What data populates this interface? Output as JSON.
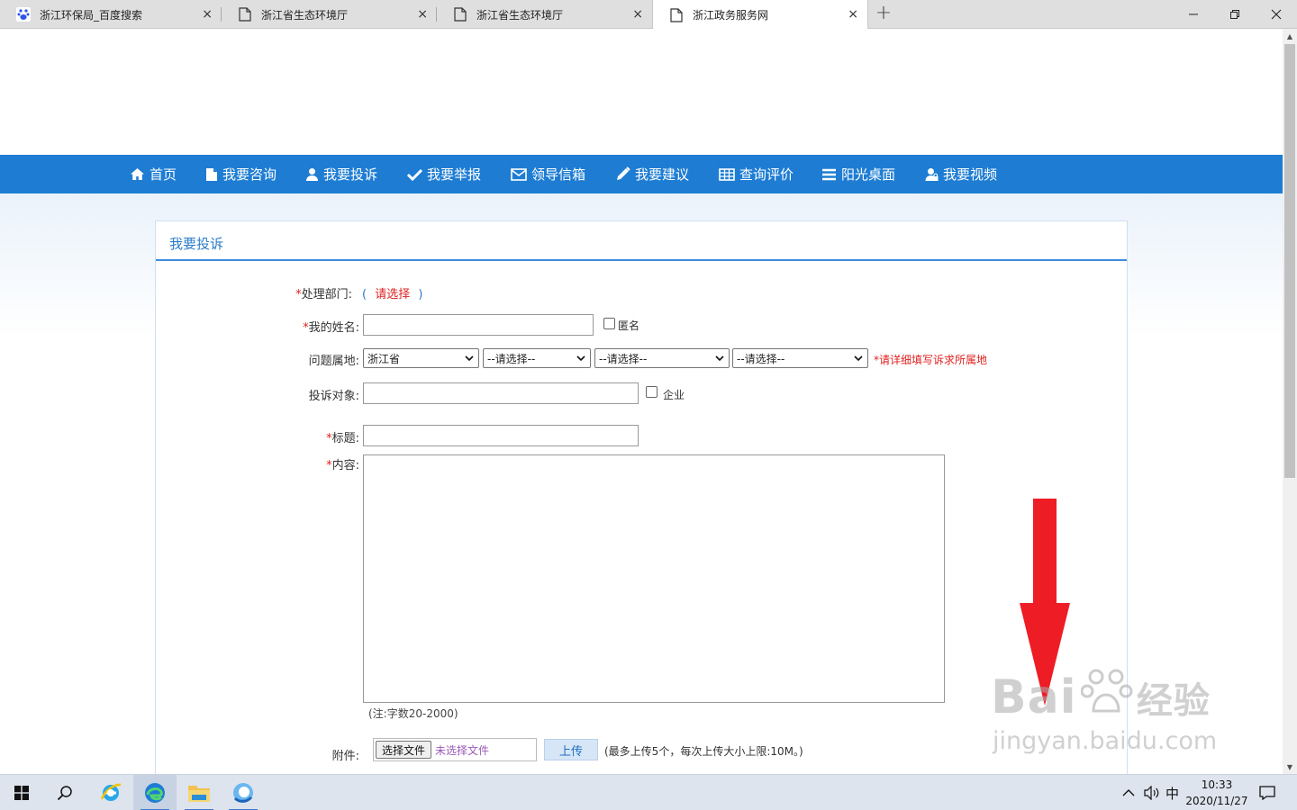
{
  "browser": {
    "tabs": [
      {
        "title": "浙江环保局_百度搜索",
        "icon": "baidu-paw-icon"
      },
      {
        "title": "浙江省生态环境厅",
        "icon": "page-icon"
      },
      {
        "title": "浙江省生态环境厅",
        "icon": "page-icon"
      },
      {
        "title": "浙江政务服务网",
        "icon": "page-icon"
      }
    ],
    "new_tab_symbol": "+",
    "close_symbol": "×"
  },
  "nav": {
    "items": [
      {
        "label": "首页",
        "icon": "home-icon"
      },
      {
        "label": "我要咨询",
        "icon": "document-icon"
      },
      {
        "label": "我要投诉",
        "icon": "user-icon"
      },
      {
        "label": "我要举报",
        "icon": "check-icon"
      },
      {
        "label": "领导信箱",
        "icon": "envelope-icon"
      },
      {
        "label": "我要建议",
        "icon": "pencil-icon"
      },
      {
        "label": "查询评价",
        "icon": "table-icon"
      },
      {
        "label": "阳光桌面",
        "icon": "list-icon"
      },
      {
        "label": "我要视频",
        "icon": "user-lock-icon"
      }
    ],
    "background": "#1e7dd3"
  },
  "form": {
    "title": "我要投诉",
    "required_mark": "*",
    "dept": {
      "label": "处理部门:",
      "open": "(",
      "choose": "请选择",
      "close": ")"
    },
    "name": {
      "label": "我的姓名:",
      "anonymous_label": "匿名"
    },
    "location": {
      "label": "问题属地:",
      "province": "浙江省",
      "city": "--请选择--",
      "county": "--请选择--",
      "town": "--请选择--",
      "hint": "*请详细填写诉求所属地"
    },
    "target": {
      "label": "投诉对象:",
      "enterprise_label": "企业"
    },
    "subject": {
      "label": "标题:"
    },
    "content": {
      "label": "内容:",
      "note": "(注:字数20-2000)"
    },
    "attachment": {
      "label": "附件:",
      "choose_button": "选择文件",
      "no_file": "未选择文件",
      "upload_button": "上传",
      "limit_note": "(最多上传5个，每次上传大小上限:10M。)"
    }
  },
  "watermark": {
    "brand": "Bai",
    "brand_suffix": "经验",
    "url": "jingyan.baidu.com"
  },
  "taskbar": {
    "ime": "中",
    "time": "10:33",
    "date": "2020/11/27",
    "apps": [
      "windows-start-icon",
      "search-icon",
      "ie-icon",
      "edge-icon",
      "file-explorer-icon",
      "edge-beta-icon"
    ]
  },
  "colors": {
    "accent": "#1e7dd3",
    "required": "#e02020",
    "arrow": "#ee1c25"
  }
}
